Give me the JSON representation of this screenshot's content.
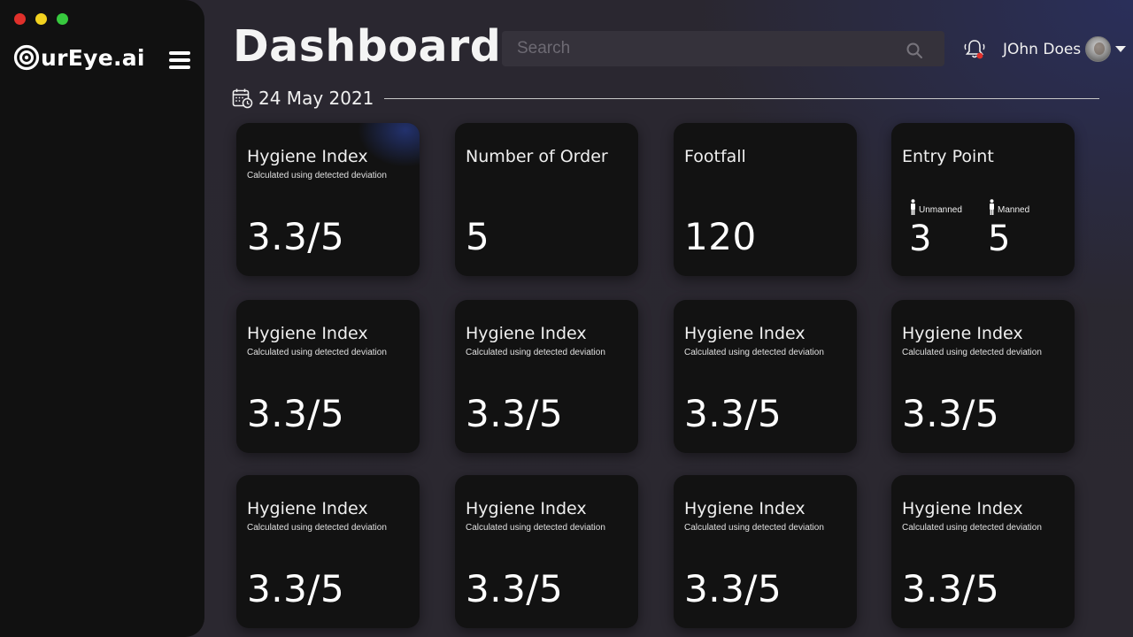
{
  "window": {
    "controls": [
      "close",
      "minimize",
      "maximize"
    ]
  },
  "brand": {
    "logo_text": "urEye.ai",
    "accent": "#e0302b"
  },
  "header": {
    "title": "Dashboard",
    "search_placeholder": "Search",
    "user_name": "JOhn Does"
  },
  "date": "24 May 2021",
  "cards": {
    "hygiene_top": {
      "title": "Hygiene Index",
      "subtitle": "Calculated using detected deviation",
      "value": "3.3/5"
    },
    "orders": {
      "title": "Number of Order",
      "value": "5"
    },
    "footfall": {
      "title": "Footfall",
      "value": "120"
    },
    "entry": {
      "title": "Entry Point",
      "unmanned_label": "Unmanned",
      "unmanned_value": "3",
      "manned_label": "Manned",
      "manned_value": "5"
    },
    "grid": [
      {
        "title": "Hygiene Index",
        "subtitle": "Calculated using detected deviation",
        "value": "3.3/5"
      },
      {
        "title": "Hygiene Index",
        "subtitle": "Calculated using detected deviation",
        "value": "3.3/5"
      },
      {
        "title": "Hygiene Index",
        "subtitle": "Calculated using detected deviation",
        "value": "3.3/5"
      },
      {
        "title": "Hygiene Index",
        "subtitle": "Calculated using detected deviation",
        "value": "3.3/5"
      },
      {
        "title": "Hygiene Index",
        "subtitle": "Calculated using detected deviation",
        "value": "3.3/5"
      },
      {
        "title": "Hygiene Index",
        "subtitle": "Calculated using detected deviation",
        "value": "3.3/5"
      },
      {
        "title": "Hygiene Index",
        "subtitle": "Calculated using detected deviation",
        "value": "3.3/5"
      },
      {
        "title": "Hygiene Index",
        "subtitle": "Calculated using detected deviation",
        "value": "3.3/5"
      }
    ]
  }
}
